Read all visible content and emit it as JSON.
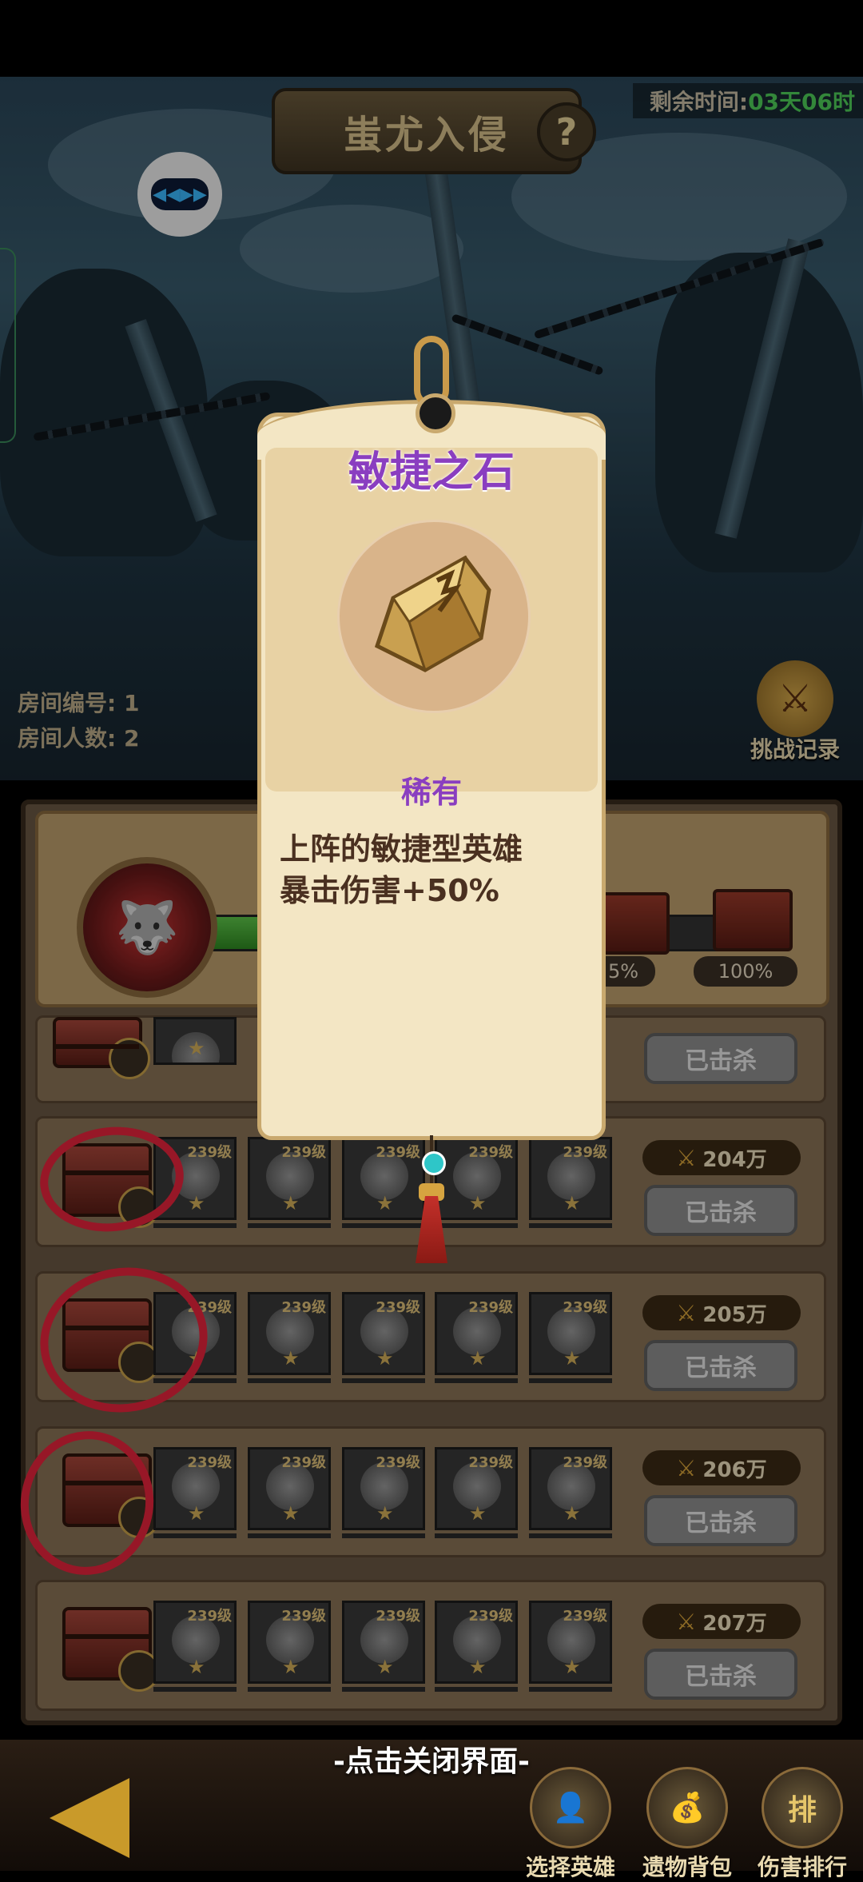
{
  "header": {
    "title": "蚩尤入侵",
    "help_label": "?",
    "timer_label": "剩余时间:",
    "timer_value": "03天06时",
    "speed_label": "◀◀▶▶"
  },
  "room": {
    "number_label": "房间编号: 1",
    "players_label": "房间人数: 2"
  },
  "record_button": {
    "icon": "⚔",
    "label": "挑战记录"
  },
  "boss": {
    "portrait_icon": "🐺",
    "progress": 0.78,
    "milestones": [
      "5%",
      "100%"
    ]
  },
  "rows": [
    {
      "power": "",
      "status": "已击杀"
    },
    {
      "power": "204万",
      "status": "已击杀",
      "level": "239级"
    },
    {
      "power": "205万",
      "status": "已击杀",
      "level": "239级"
    },
    {
      "power": "206万",
      "status": "已击杀",
      "level": "239级"
    },
    {
      "power": "207万",
      "status": "已击杀",
      "level": "239级"
    }
  ],
  "popup": {
    "item_name": "敏捷之石",
    "rarity": "稀有",
    "description_line1": "上阵的敏捷型英雄",
    "description_line2": "暴击伤害+50%",
    "close_hint": "-点击关闭界面-"
  },
  "bottom_nav": [
    {
      "icon": "👤",
      "label": "选择英雄"
    },
    {
      "icon": "💰",
      "label": "遗物背包"
    },
    {
      "icon": "排",
      "label": "伤害排行"
    }
  ],
  "colors": {
    "accent_purple": "#8a3ec0",
    "timer_green": "#4fcf5a",
    "annotation_red": "#e8243c"
  }
}
